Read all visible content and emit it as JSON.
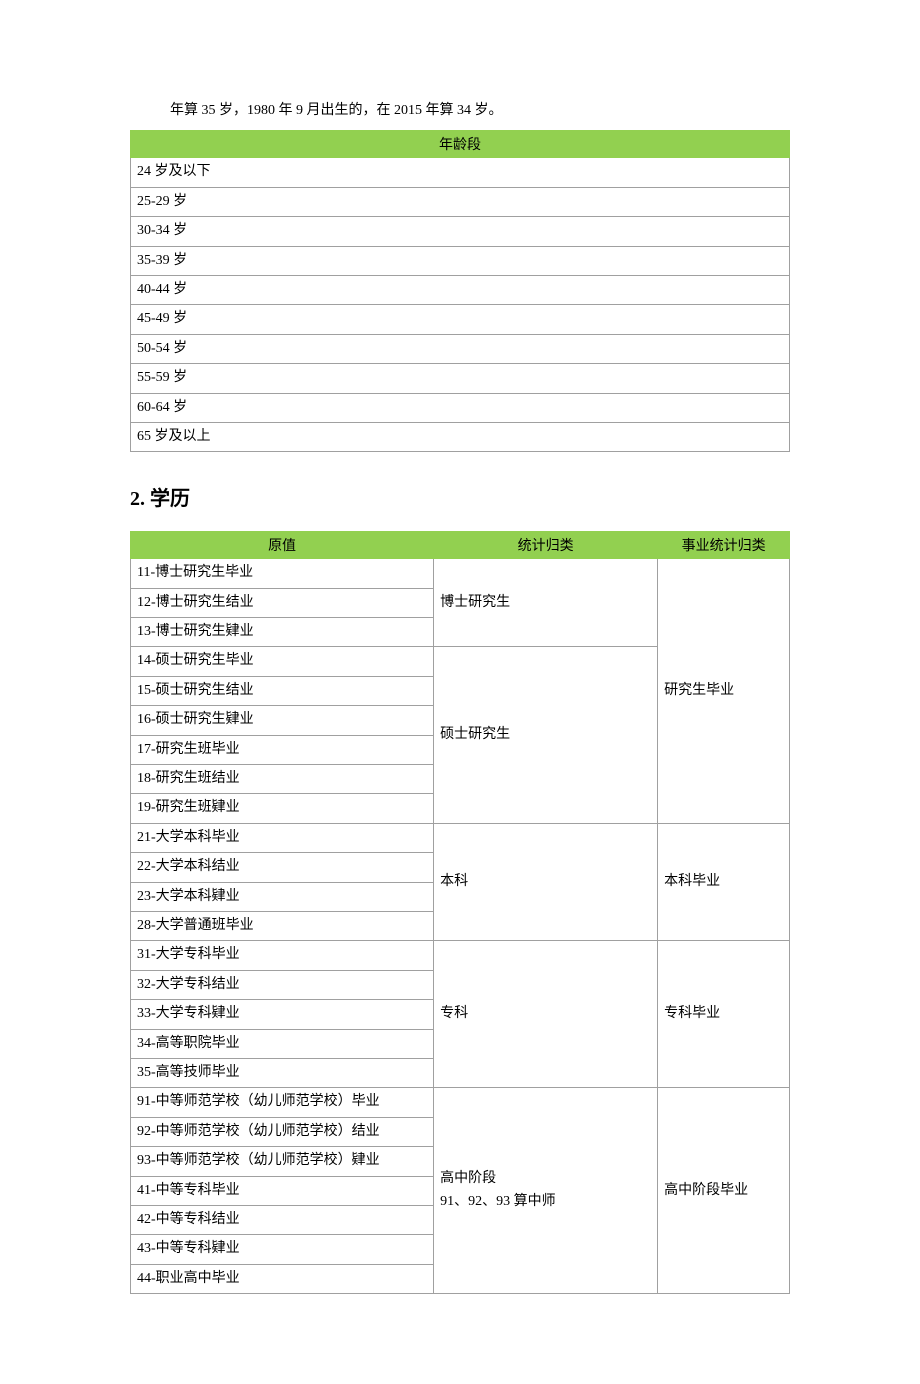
{
  "intro": "年算 35 岁，1980 年 9 月出生的，在 2015 年算 34 岁。",
  "table1": {
    "header": "年龄段",
    "rows": [
      "24 岁及以下",
      "25-29 岁",
      "30-34 岁",
      "35-39 岁",
      "40-44 岁",
      "45-49 岁",
      "50-54 岁",
      "55-59 岁",
      "60-64 岁",
      "65 岁及以上"
    ]
  },
  "section2_title": "2. 学历",
  "table2": {
    "headers": [
      "原值",
      "统计归类",
      "事业统计归类"
    ],
    "rows": [
      {
        "c1": "11-博士研究生毕业"
      },
      {
        "c1": "12-博士研究生结业"
      },
      {
        "c1": "13-博士研究生肄业",
        "end": true
      },
      {
        "c1": "14-硕士研究生毕业"
      },
      {
        "c1": "15-硕士研究生结业"
      },
      {
        "c1": "16-硕士研究生肄业"
      },
      {
        "c1": "17-研究生班毕业"
      },
      {
        "c1": "18-研究生班结业"
      },
      {
        "c1": "19-研究生班肄业",
        "end": true
      },
      {
        "c1": "21-大学本科毕业"
      },
      {
        "c1": "22-大学本科结业"
      },
      {
        "c1": "23-大学本科肄业"
      },
      {
        "c1": "28-大学普通班毕业",
        "end": true
      },
      {
        "c1": "31-大学专科毕业"
      },
      {
        "c1": "32-大学专科结业"
      },
      {
        "c1": "33-大学专科肄业"
      },
      {
        "c1": "34-高等职院毕业"
      },
      {
        "c1": "35-高等技师毕业",
        "end": true
      },
      {
        "c1": "91-中等师范学校（幼儿师范学校）毕业"
      },
      {
        "c1": "92-中等师范学校（幼儿师范学校）结业"
      },
      {
        "c1": "93-中等师范学校（幼儿师范学校）肄业"
      },
      {
        "c1": "41-中等专科毕业"
      },
      {
        "c1": "42-中等专科结业"
      },
      {
        "c1": "43-中等专科肄业"
      },
      {
        "c1": "44-职业高中毕业",
        "end": true
      }
    ],
    "stat_groups": [
      {
        "text": "博士研究生",
        "span": 3
      },
      {
        "text": "硕士研究生",
        "span": 6
      },
      {
        "text": "本科",
        "span": 4
      },
      {
        "text": "专科",
        "span": 5
      },
      {
        "text": "高中阶段\n91、92、93 算中师",
        "span": 7
      }
    ],
    "career_groups": [
      {
        "text": "研究生毕业",
        "span": 9
      },
      {
        "text": "本科毕业",
        "span": 4
      },
      {
        "text": "专科毕业",
        "span": 5
      },
      {
        "text": "高中阶段毕业",
        "span": 7
      }
    ]
  }
}
